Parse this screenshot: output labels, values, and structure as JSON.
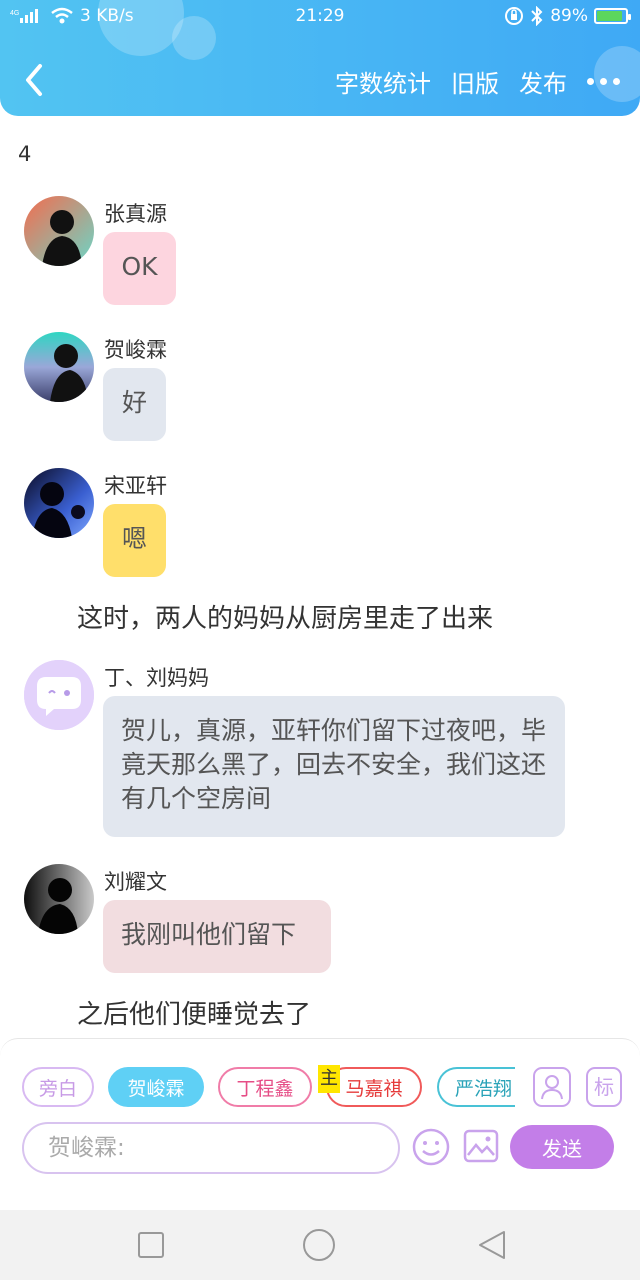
{
  "status": {
    "network": "3 KB/s",
    "time": "21:29",
    "battery": "89%",
    "battery_level": 0.89
  },
  "header": {
    "actions": [
      "字数统计",
      "旧版",
      "发布"
    ]
  },
  "page_number": "4",
  "messages": [
    {
      "speaker": "张真源",
      "text": "OK"
    },
    {
      "speaker": "贺峻霖",
      "text": "好"
    },
    {
      "speaker": "宋亚轩",
      "text": "嗯"
    },
    {
      "speaker": "丁、刘妈妈",
      "text": "贺儿，真源，亚轩你们留下过夜吧，毕竟天那么黑了，回去不安全，我们这还有几个空房间"
    },
    {
      "speaker": "刘耀文",
      "text": "我刚叫他们留下"
    }
  ],
  "narrations": [
    "这时，两人的妈妈从厨房里走了出来",
    "之后他们便睡觉去了"
  ],
  "composer": {
    "chips": [
      "旁白",
      "贺峻霖",
      "丁程鑫",
      "马嘉祺",
      "严浩翔"
    ],
    "host_tag": "主",
    "tag_button": "标",
    "input_placeholder": "贺峻霖:",
    "send_label": "发送"
  },
  "colors": {
    "header": "#4ab8f3",
    "bubble_pink": "#fdd5df",
    "bubble_gray": "#e2e7ef",
    "bubble_yellow": "#ffdf6b",
    "bubble_rose": "#f2dde0",
    "chip_selected": "#5fd0f5",
    "send": "#c37ee8"
  }
}
